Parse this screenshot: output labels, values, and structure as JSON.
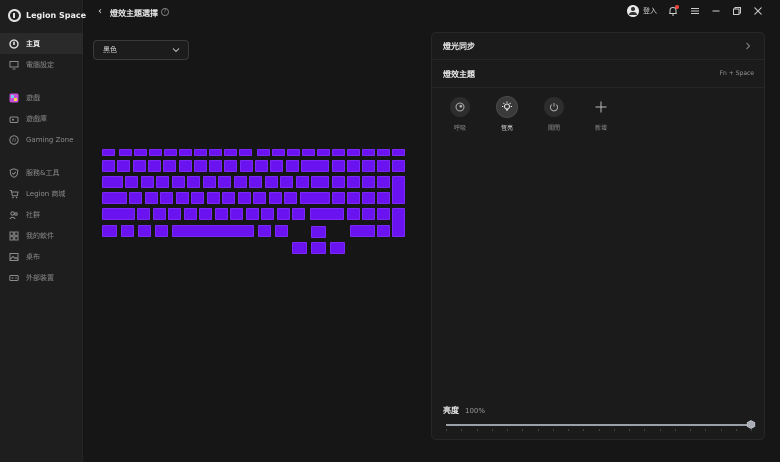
{
  "app": {
    "name": "Legion Space"
  },
  "sidebar": {
    "items": [
      {
        "label": "主頁",
        "icon": "home-icon",
        "active": true
      },
      {
        "label": "電腦設定",
        "icon": "monitor-icon"
      },
      {
        "label": "遊戲",
        "icon": "game-icon"
      },
      {
        "label": "遊戲庫",
        "icon": "library-icon"
      },
      {
        "label": "Gaming Zone",
        "icon": "ai-icon"
      },
      {
        "label": "服務&工具",
        "icon": "shield-icon"
      },
      {
        "label": "Legion 商城",
        "icon": "cart-icon"
      },
      {
        "label": "社群",
        "icon": "community-icon"
      },
      {
        "label": "我的軟件",
        "icon": "apps-icon"
      },
      {
        "label": "桌布",
        "icon": "wallpaper-icon"
      },
      {
        "label": "外部裝置",
        "icon": "device-icon"
      }
    ]
  },
  "header": {
    "back_icon": "chevron-left-icon",
    "title": "燈效主題選擇",
    "help_icon": "help-icon",
    "login_label": "登入"
  },
  "color_select": {
    "value": "黑色"
  },
  "keyboard": {
    "color": "#6a12f0"
  },
  "panel": {
    "sync_label": "燈光同步",
    "theme_title": "燈效主題",
    "shortcut": "Fn + Space",
    "effects": [
      {
        "label": "呼吸",
        "icon": "breathe-icon",
        "selected": false
      },
      {
        "label": "恆亮",
        "icon": "bulb-icon",
        "selected": true
      },
      {
        "label": "關閉",
        "icon": "power-icon",
        "selected": false
      },
      {
        "label": "新增",
        "icon": "plus-icon",
        "selected": false
      }
    ],
    "brightness_label": "亮度",
    "brightness_value": "100%",
    "brightness_fraction": 1.0
  }
}
